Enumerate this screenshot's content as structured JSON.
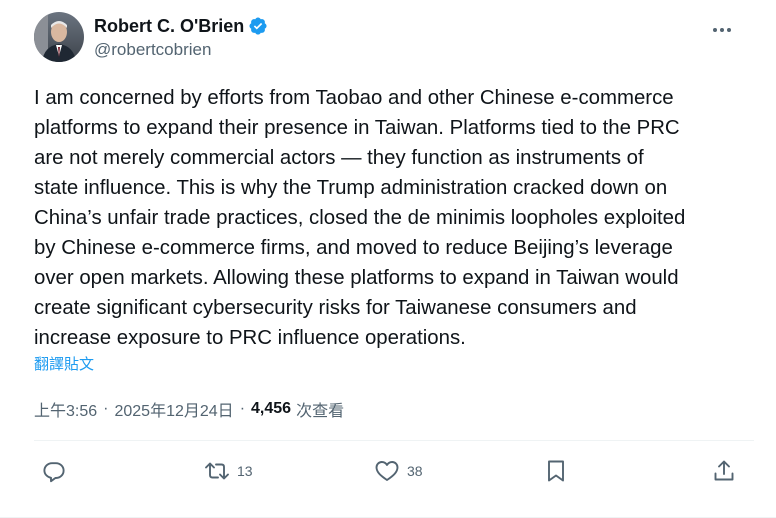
{
  "author": {
    "display_name": "Robert C. O'Brien",
    "handle": "@robertcobrien",
    "verified": true
  },
  "tweet": {
    "text": "I am concerned by efforts from Taobao and other Chinese e-commerce\nplatforms to expand their presence in Taiwan. Platforms tied to the PRC\nare not merely commercial actors — they function as instruments of\nstate influence. This is why the Trump administration cracked down on\nChina’s unfair trade practices, closed the de minimis loopholes exploited\nby Chinese e-commerce firms, and moved to reduce Beijing’s leverage\nover open markets. Allowing these platforms to expand in Taiwan would\ncreate significant cybersecurity risks for Taiwanese consumers and\nincrease exposure to PRC influence operations.",
    "translate_label": "翻譯貼文",
    "time": "上午3:56",
    "date": "2025年12月24日",
    "separator": "·",
    "views_count": "4,456",
    "views_label": "次查看"
  },
  "actions": {
    "reply_count": "",
    "retweet_count": "13",
    "like_count": "38"
  },
  "icons": {
    "more": "more-horizontal-icon",
    "verified": "verified-badge-icon",
    "reply": "reply-icon",
    "retweet": "retweet-icon",
    "like": "heart-icon",
    "bookmark": "bookmark-icon",
    "share": "share-icon"
  },
  "colors": {
    "text": "#0f1419",
    "secondary": "#536471",
    "link": "#1d9bf0",
    "verified": "#1d9bf0",
    "divider": "#eff3f4"
  }
}
